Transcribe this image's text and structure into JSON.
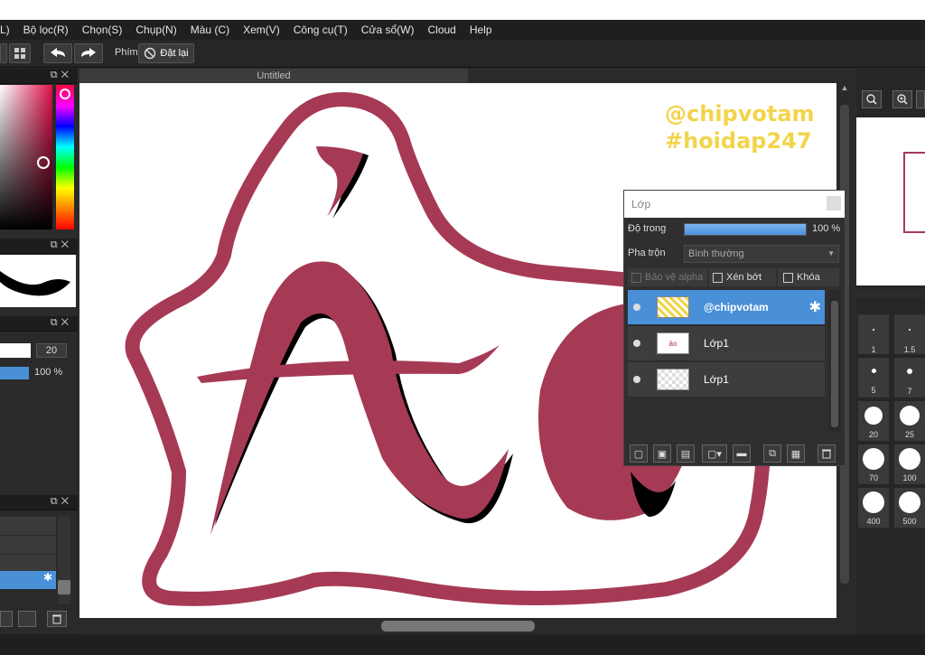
{
  "menu": [
    "L)",
    "Bộ lọc(R)",
    "Chọn(S)",
    "Chụp(N)",
    "Màu (C)",
    "Xem(V)",
    "Công cụ(T)",
    "Cửa sổ(W)",
    "Cloud",
    "Help"
  ],
  "toolbar": {
    "keys_label": "Phím",
    "reset_label": "Đặt lại"
  },
  "canvas": {
    "tab_title": "Untitled",
    "watermark_line1": "@chipvotam",
    "watermark_line2": "#hoidap247",
    "drawing_text": "ảo"
  },
  "left": {
    "brush_size": "20",
    "opacity": "100 %"
  },
  "layer_panel": {
    "title": "Lớp",
    "opacity_label": "Độ trong",
    "opacity_value": "100 %",
    "opacity_fraction": 1.0,
    "blend_label": "Pha trộn",
    "blend_value": "Bình thường",
    "protect_alpha": "Bảo vệ alpha",
    "clip": "Xén bớt",
    "lock": "Khóa",
    "layers": [
      {
        "name": "@chipvotam",
        "selected": true
      },
      {
        "name": "Lớp1",
        "selected": false
      },
      {
        "name": "Lớp1",
        "selected": false
      }
    ]
  },
  "brush_sizes": [
    "1",
    "1.5",
    "5",
    "7",
    "20",
    "25",
    "70",
    "100",
    "400",
    "500"
  ],
  "colors": {
    "accent": "#4a90d9",
    "drawing": "#a63a55",
    "watermark": "#f2d44a"
  },
  "icons": [
    "undo-icon",
    "redo-icon",
    "prohibit-icon",
    "gear-icon",
    "zoom-out-icon",
    "zoom-in-icon",
    "trash-icon"
  ]
}
